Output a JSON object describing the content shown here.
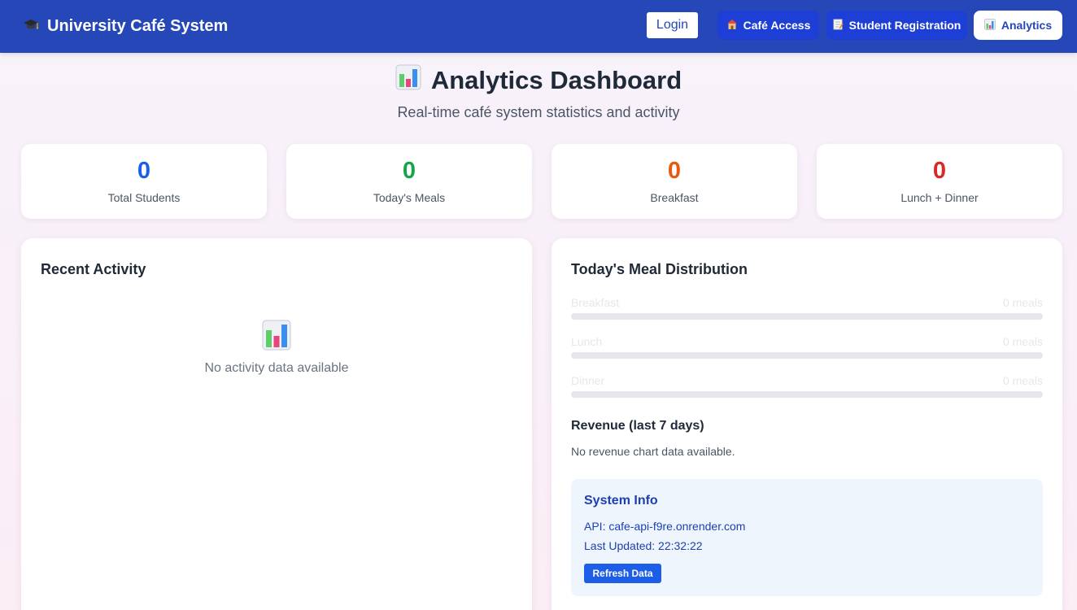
{
  "header": {
    "brand": "University Café System",
    "login_label": "Login",
    "nav": [
      {
        "label": "Café Access",
        "icon": "house-icon"
      },
      {
        "label": "Student Registration",
        "icon": "memo-icon"
      },
      {
        "label": "Analytics",
        "icon": "bar-chart-icon",
        "active": true
      }
    ]
  },
  "page": {
    "title": "Analytics Dashboard",
    "subtitle": "Real-time café system statistics and activity"
  },
  "stats": [
    {
      "value": "0",
      "label": "Total Students",
      "color": "#1d5ee8"
    },
    {
      "value": "0",
      "label": "Today's Meals",
      "color": "#16a34a"
    },
    {
      "value": "0",
      "label": "Breakfast",
      "color": "#ea580c"
    },
    {
      "value": "0",
      "label": "Lunch + Dinner",
      "color": "#dc2626"
    }
  ],
  "recent_activity": {
    "title": "Recent Activity",
    "empty_text": "No activity data available"
  },
  "distribution": {
    "title": "Today's Meal Distribution",
    "meals": [
      {
        "name": "Breakfast",
        "count_text": "0 meals",
        "fraction": 0
      },
      {
        "name": "Lunch",
        "count_text": "0 meals",
        "fraction": 0
      },
      {
        "name": "Dinner",
        "count_text": "0 meals",
        "fraction": 0
      }
    ],
    "revenue_title": "Revenue (last 7 days)",
    "revenue_text": "No revenue chart data available."
  },
  "system_info": {
    "title": "System Info",
    "api": "API: cafe-api-f9re.onrender.com",
    "last_updated": "Last Updated: 22:32:22",
    "refresh_label": "Refresh Data"
  },
  "colors": {
    "header_bg": "#2547b8",
    "nav_button_bg": "#1d3fd6",
    "accent": "#1d5ee8"
  }
}
